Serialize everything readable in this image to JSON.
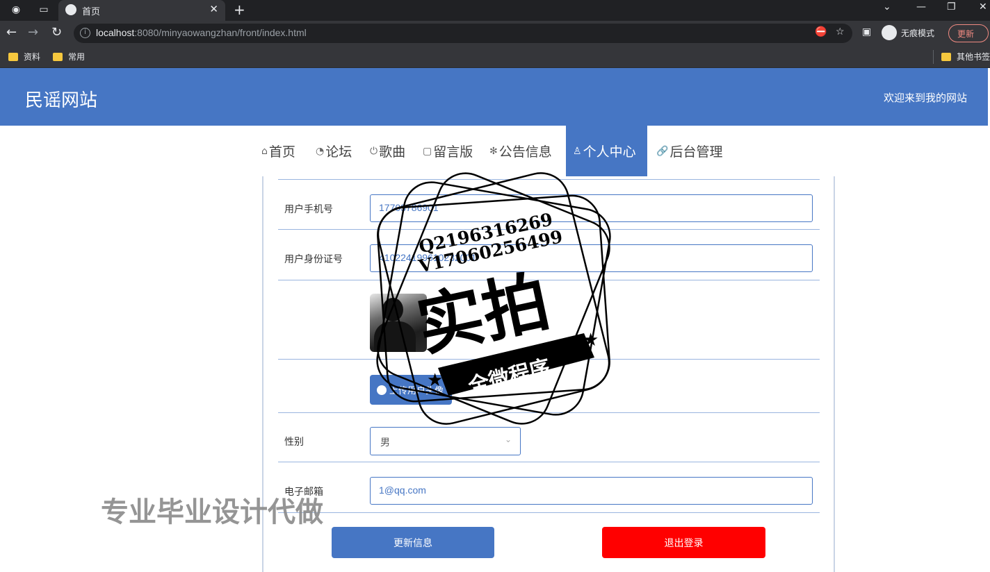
{
  "browser": {
    "tab_title": "首页",
    "url_host": "localhost",
    "url_rest": ":8080/minyaowangzhan/front/index.html",
    "incognito_label": "无痕模式",
    "update_label": "更新",
    "bookmarks": [
      {
        "label": "资料",
        "icon": "folder-icon"
      },
      {
        "label": "常用",
        "icon": "folder-icon"
      }
    ],
    "other_bookmarks": "其他书签"
  },
  "site": {
    "title": "民谣网站",
    "welcome": "欢迎来到我的网站",
    "accent": "#4676c4"
  },
  "nav": [
    {
      "label": "首页",
      "icon": "home-icon",
      "glyph": "⌂"
    },
    {
      "label": "论坛",
      "icon": "gauge-icon",
      "glyph": "◔"
    },
    {
      "label": "歌曲",
      "icon": "power-icon",
      "glyph": "⏻"
    },
    {
      "label": "留言版",
      "icon": "note-icon",
      "glyph": "▢"
    },
    {
      "label": "公告信息",
      "icon": "gear-icon",
      "glyph": "✻"
    },
    {
      "label": "个人中心",
      "icon": "user-icon",
      "glyph": "♙",
      "active": true
    },
    {
      "label": "后台管理",
      "icon": "link-icon",
      "glyph": "🔗"
    }
  ],
  "form": {
    "phone_label": "用户手机号",
    "phone_value": "17703786901",
    "idcard_label": "用户身份证号",
    "idcard_value": "410224199610232001",
    "upload_label": "上传用户头像",
    "gender_label": "性别",
    "gender_value": "男",
    "email_label": "电子邮箱",
    "email_value": "1@qq.com",
    "update_button": "更新信息",
    "logout_button": "退出登录"
  },
  "watermark": {
    "qq": "Q2196316269",
    "v": "V17060256499",
    "big": "实拍",
    "banner": "全微程序",
    "bottom": "专业毕业设计代做"
  }
}
